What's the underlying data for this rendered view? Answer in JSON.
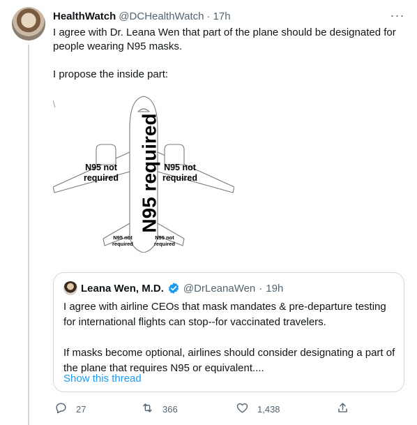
{
  "tweet": {
    "author_name": "HealthWatch",
    "author_handle": "@DCHealthWatch",
    "separator": "·",
    "time": "17h",
    "more_glyph": "···",
    "text_line1": "I agree with Dr. Leana Wen that part of the plane should be designated for people wearing N95 masks.",
    "text_line2": "I propose the inside part:"
  },
  "media": {
    "center_label": "N95 required",
    "left_wing_label_1": "N95 not",
    "left_wing_label_2": "required",
    "right_wing_label_1": "N95 not",
    "right_wing_label_2": "required",
    "left_tail_label_1": "N95 not",
    "left_tail_label_2": "required",
    "right_tail_label_1": "N95 not",
    "right_tail_label_2": "required"
  },
  "quote": {
    "author_name": "Leana Wen, M.D.",
    "author_handle": "@DrLeanaWen",
    "separator": "·",
    "time": "19h",
    "text_para1": "I agree with airline CEOs that mask mandates & pre-departure testing for international flights can stop--for vaccinated travelers.",
    "text_para2": "If masks become optional, airlines should consider designating a part of the plane that requires N95 or equivalent....",
    "show_thread": "Show this thread"
  },
  "actions": {
    "replies": "27",
    "retweets": "366",
    "likes": "1,438"
  },
  "colors": {
    "accent": "#1d9bf0",
    "secondary_text": "#536471",
    "border": "#cfd9de"
  }
}
